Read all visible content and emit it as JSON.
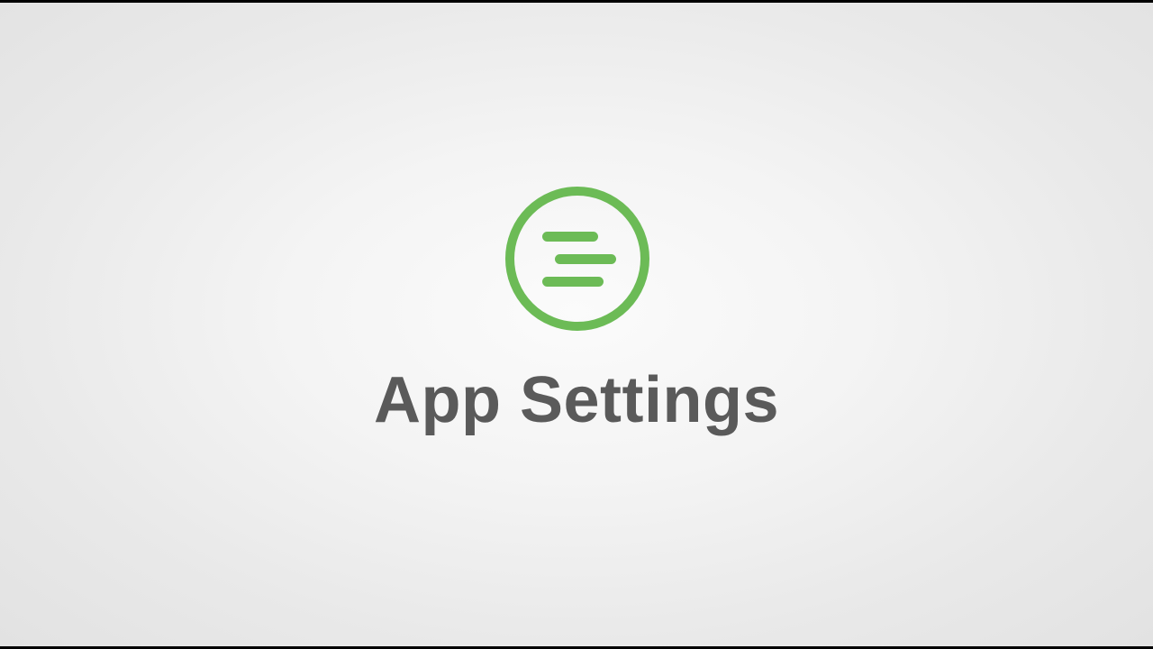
{
  "screen": {
    "title": "App Settings",
    "logo_icon": "menu-lines-circle-icon",
    "colors": {
      "accent": "#6cbb56",
      "title_text": "#5a5a5a",
      "background": "#f1f1f1",
      "border": "#000000"
    }
  }
}
